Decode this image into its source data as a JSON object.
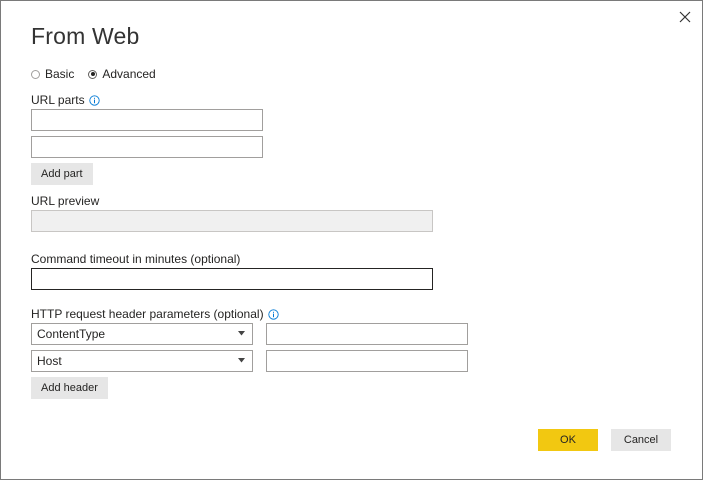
{
  "dialog": {
    "title": "From Web",
    "close_icon": "close-icon"
  },
  "mode": {
    "options": [
      {
        "label": "Basic",
        "checked": false
      },
      {
        "label": "Advanced",
        "checked": true
      }
    ]
  },
  "url_parts": {
    "label": "URL parts",
    "info_icon": "info-icon",
    "part1_value": "",
    "part2_value": "",
    "add_part_label": "Add part"
  },
  "url_preview": {
    "label": "URL preview",
    "value": ""
  },
  "command_timeout": {
    "label": "Command timeout in minutes (optional)",
    "value": ""
  },
  "http_headers": {
    "label": "HTTP request header parameters (optional)",
    "info_icon": "info-icon",
    "rows": [
      {
        "name": "ContentType",
        "value": ""
      },
      {
        "name": "Host",
        "value": ""
      }
    ],
    "add_header_label": "Add header"
  },
  "footer": {
    "ok_label": "OK",
    "cancel_label": "Cancel"
  },
  "colors": {
    "accent": "#f2c811",
    "secondary_button": "#e6e6e6",
    "border": "#a19f9d"
  }
}
